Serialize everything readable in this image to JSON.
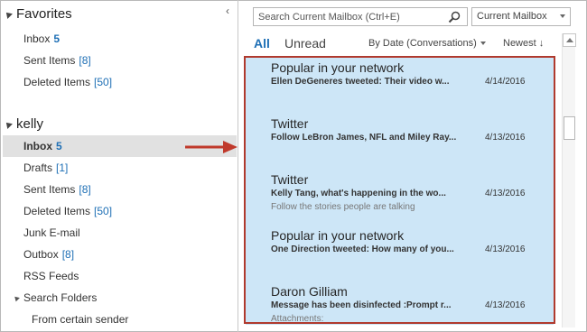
{
  "favorites": {
    "header": "Favorites",
    "collapse_glyph": "‹",
    "items": [
      {
        "label": "Inbox",
        "count": "5"
      },
      {
        "label": "Sent Items",
        "count": "[8]"
      },
      {
        "label": "Deleted Items",
        "count": "[50]"
      }
    ]
  },
  "account": {
    "header": "kelly",
    "items": [
      {
        "label": "Inbox",
        "count": "5"
      },
      {
        "label": "Drafts",
        "count": "[1]"
      },
      {
        "label": "Sent Items",
        "count": "[8]"
      },
      {
        "label": "Deleted Items",
        "count": "[50]"
      },
      {
        "label": "Junk E-mail",
        "count": ""
      },
      {
        "label": "Outbox",
        "count": "[8]"
      },
      {
        "label": "RSS Feeds",
        "count": ""
      },
      {
        "label": "Search Folders",
        "count": ""
      },
      {
        "label": "From certain sender",
        "count": ""
      }
    ]
  },
  "search": {
    "placeholder": "Search Current Mailbox (Ctrl+E)",
    "scope": "Current Mailbox"
  },
  "filters": {
    "all": "All",
    "unread": "Unread",
    "sort_by": "By Date (Conversations)",
    "sort_order": "Newest ↓"
  },
  "messages": [
    {
      "sender": "Popular in your network",
      "subject": "Ellen DeGeneres tweeted: Their video w...",
      "date": "4/14/2016",
      "preview": ""
    },
    {
      "sender": "Twitter",
      "subject": "Follow LeBron James, NFL and Miley Ray...",
      "date": "4/13/2016",
      "preview": ""
    },
    {
      "sender": "Twitter",
      "subject": "Kelly Tang, what's happening in the wo...",
      "date": "4/13/2016",
      "preview": "Follow the stories people are talking"
    },
    {
      "sender": "Popular in your network",
      "subject": "One Direction tweeted: How many of you...",
      "date": "4/13/2016",
      "preview": ""
    },
    {
      "sender": "Daron Gilliam",
      "subject": "Message has been disinfected :Prompt r...",
      "date": "4/13/2016",
      "preview": "Attachments:"
    }
  ],
  "colors": {
    "accent": "#1e6fb5",
    "selection": "#cde6f7",
    "highlight_border": "#b03a2e",
    "arrow": "#c0392b"
  }
}
